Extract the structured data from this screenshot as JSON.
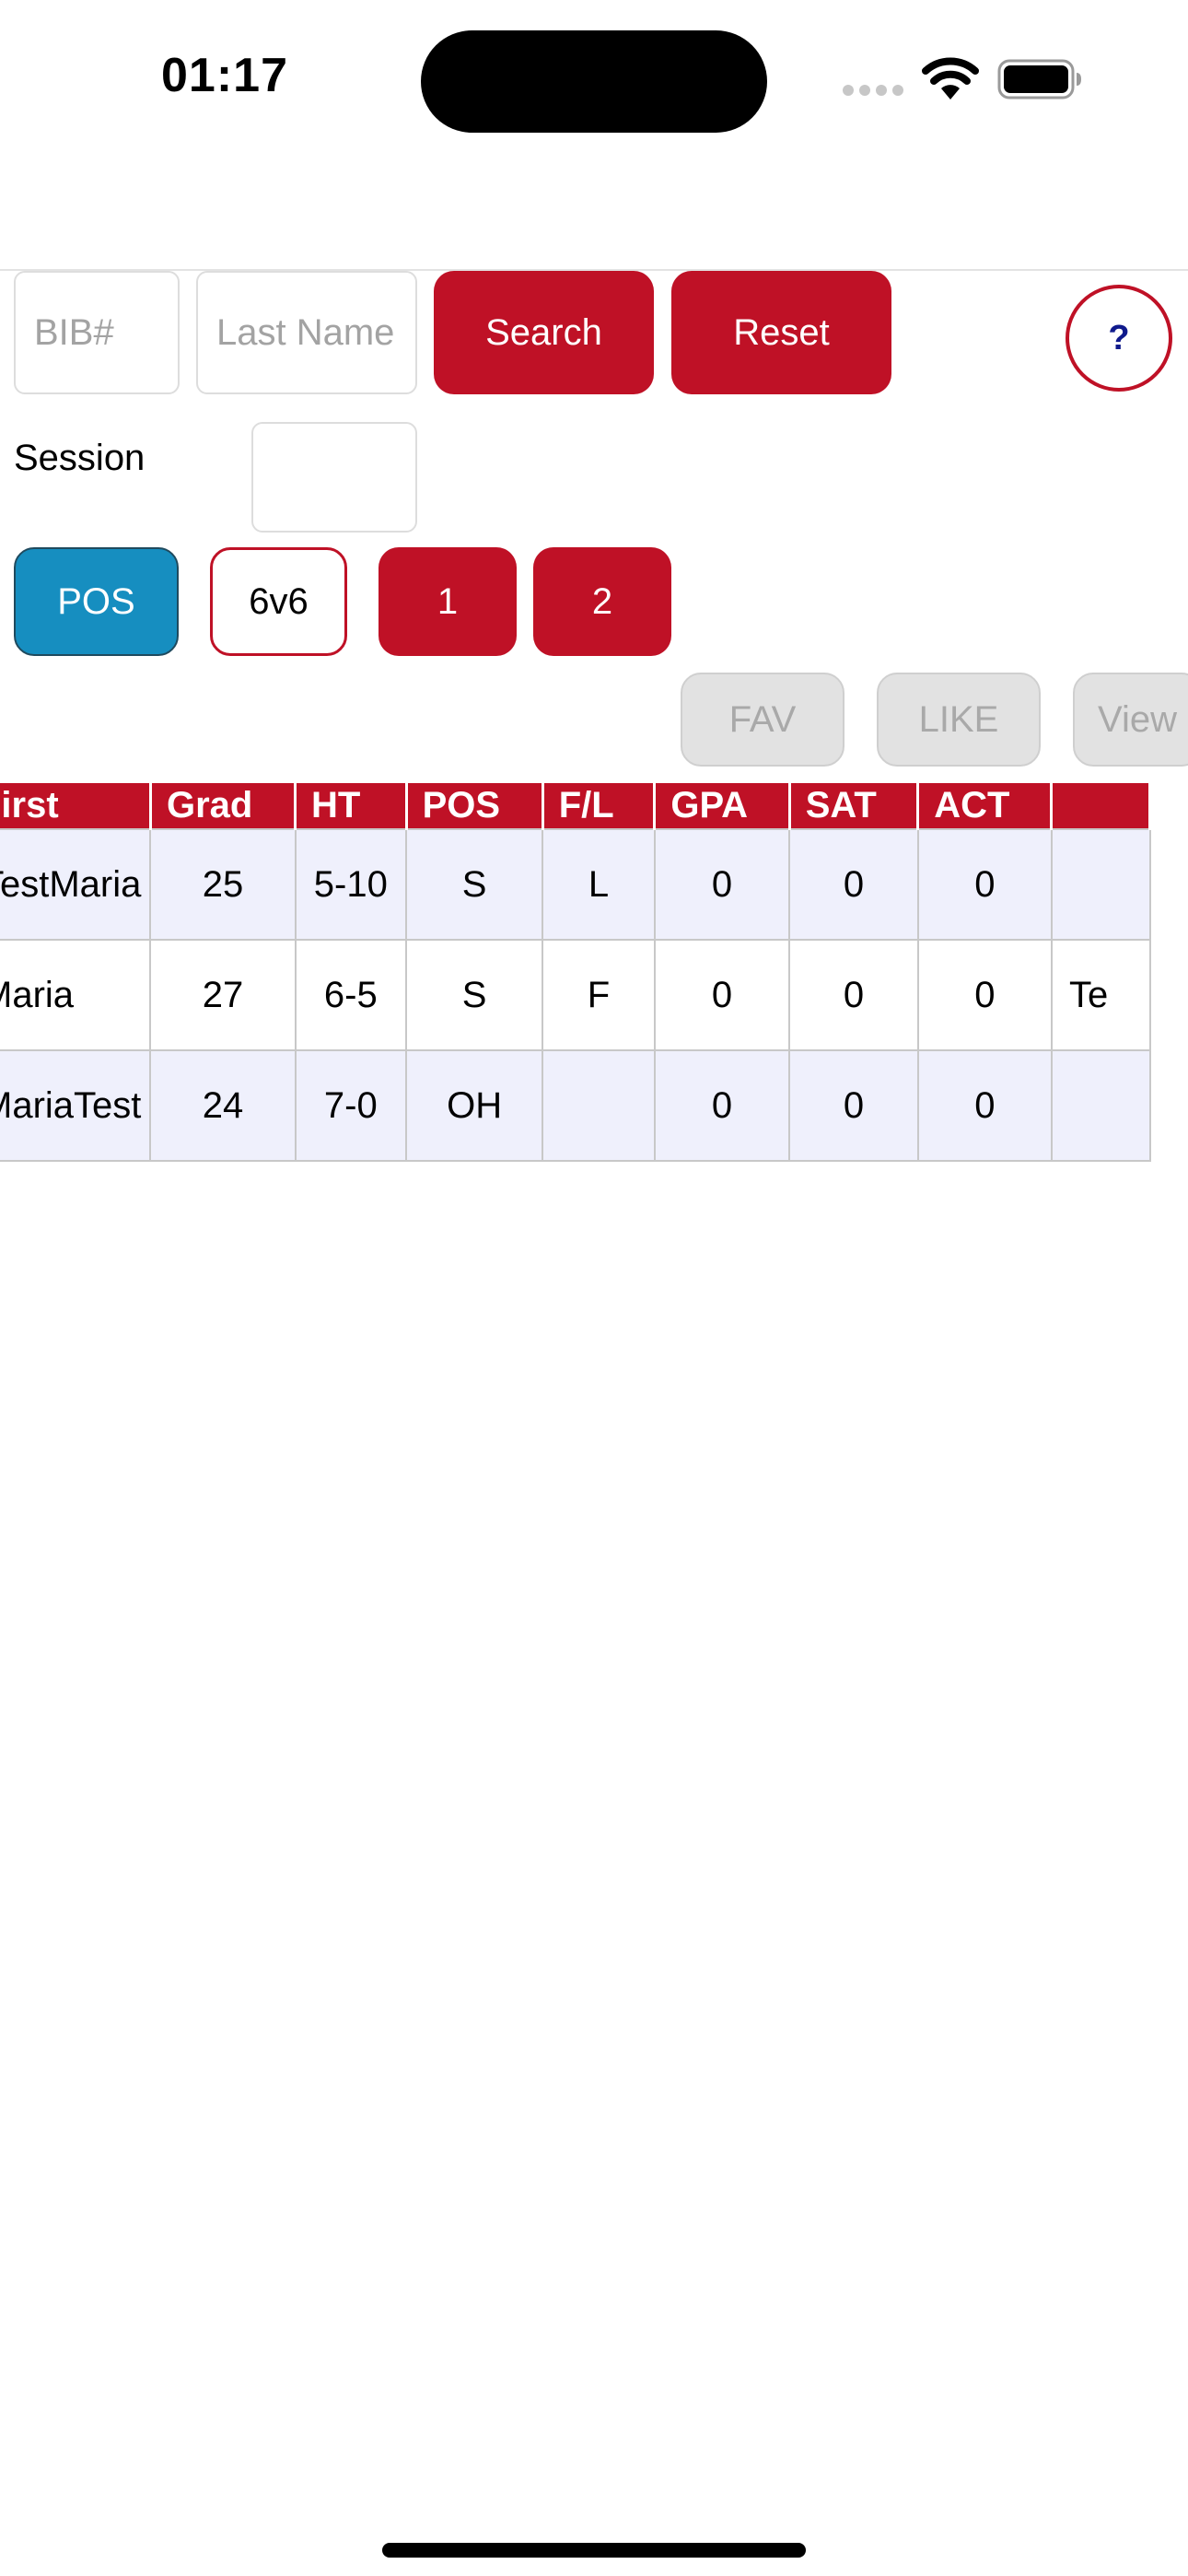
{
  "status_bar": {
    "time": "01:17"
  },
  "search": {
    "bib_placeholder": "BIB#",
    "lastname_placeholder": "Last Name",
    "search_label": "Search",
    "reset_label": "Reset",
    "help_label": "?"
  },
  "session": {
    "label": "Session",
    "value": ""
  },
  "filters": {
    "pos_label": "POS",
    "format_label": "6v6",
    "session_1_label": "1",
    "session_2_label": "2"
  },
  "actions": {
    "fav_label": "FAV",
    "like_label": "LIKE",
    "view_label": "View"
  },
  "table": {
    "headers": [
      "First",
      "Grad",
      "HT",
      "POS",
      "F/L",
      "GPA",
      "SAT",
      "ACT",
      ""
    ],
    "rows": [
      [
        "TestMaria",
        "25",
        "5-10",
        "S",
        "L",
        "0",
        "0",
        "0",
        ""
      ],
      [
        "Maria",
        "27",
        "6-5",
        "S",
        "F",
        "0",
        "0",
        "0",
        "Te"
      ],
      [
        "MariaTest",
        "24",
        "7-0",
        "OH",
        "",
        "0",
        "0",
        "0",
        ""
      ]
    ]
  },
  "colors": {
    "brand_red": "#bf1126",
    "pos_blue": "#168ec0",
    "row_shade": "#eff0fc",
    "help_text": "#0f1a8c"
  },
  "icons": [
    "signal-icon",
    "wifi-icon",
    "battery-icon"
  ]
}
